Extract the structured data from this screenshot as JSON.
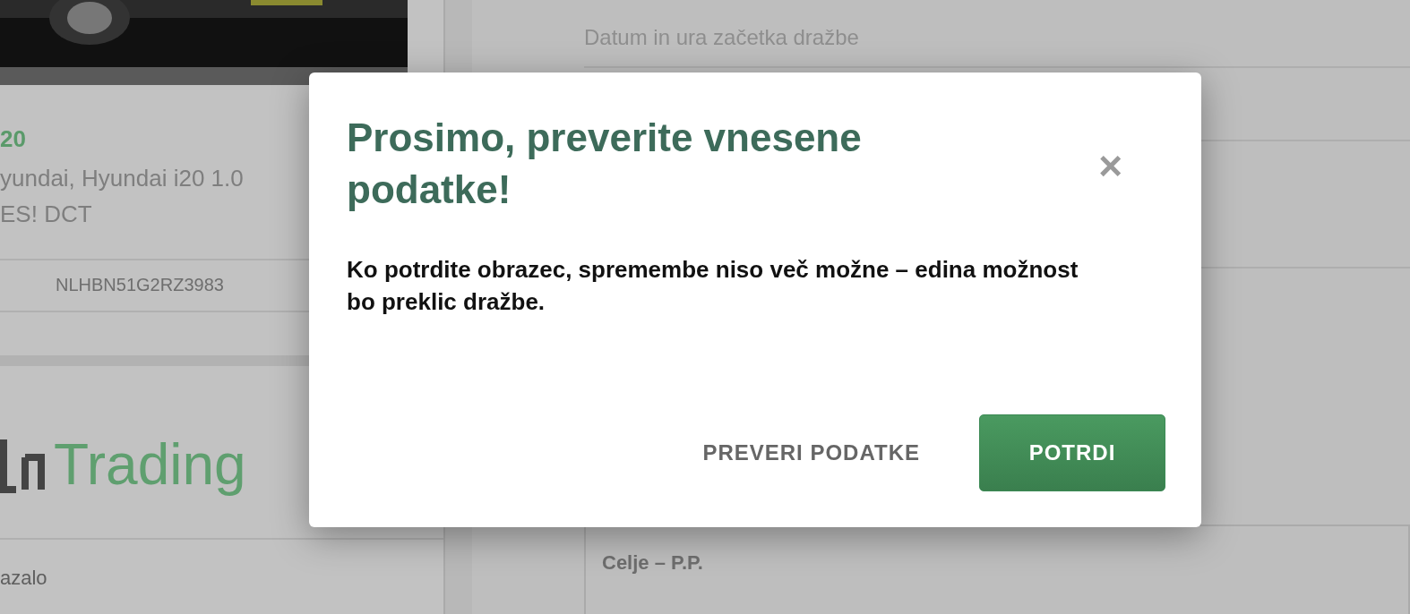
{
  "background": {
    "vehicle_title": "20",
    "description_lines": [
      "yundai, Hyundai i20 1.0",
      "ES! DCT"
    ],
    "vin": "NLHBN51G2RZ3983",
    "logo_text": "Trading",
    "footer_text": "azalo",
    "field_label": "Datum in ura začetka dražbe",
    "location_value": "Celje – P.P."
  },
  "dialog": {
    "title": "Prosimo, preverite vnesene podatke!",
    "close": "×",
    "message": "Ko potrdite obrazec, spremembe niso več možne – edina možnost bo preklic dražbe.",
    "buttons": [
      {
        "label": "PREVERI PODATKE",
        "kind": "text"
      },
      {
        "label": "POTRDI",
        "kind": "primary"
      }
    ]
  }
}
